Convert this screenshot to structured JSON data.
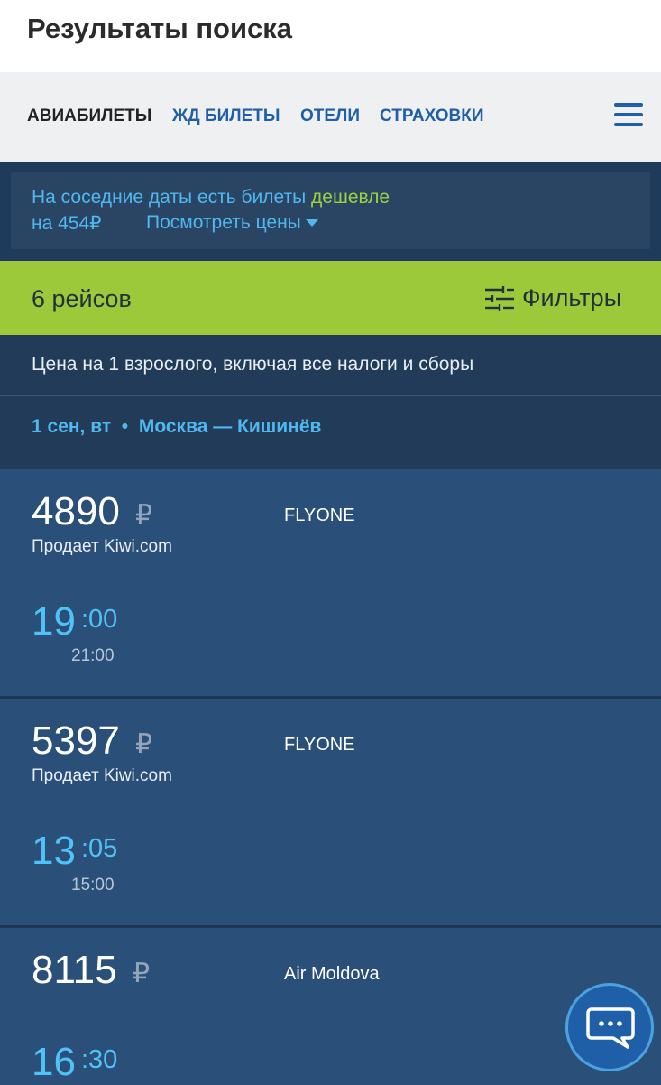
{
  "header": {
    "title": "Результаты поиска"
  },
  "nav": {
    "tabs": [
      {
        "label": "АВИАБИЛЕТЫ",
        "active": true
      },
      {
        "label": "ЖД БИЛЕТЫ",
        "active": false
      },
      {
        "label": "ОТЕЛИ",
        "active": false
      },
      {
        "label": "СТРАХОВКИ",
        "active": false
      }
    ],
    "menu_icon": "hamburger-menu-icon"
  },
  "notice": {
    "text_before": "На соседние даты есть билеты ",
    "cheaper": "дешевле",
    "amount": "на 454₽",
    "link": "Посмотреть цены"
  },
  "results": {
    "count": "6 рейсов",
    "filters_label": "Фильтры",
    "filters_icon": "sliders-icon"
  },
  "price_note": "Цена на 1 взрослого, включая все налоги и сборы",
  "route": {
    "text": "1 сен, вт  •  Москва — Кишинёв"
  },
  "flights": [
    {
      "price": "4890",
      "currency": "₽",
      "seller": "Продает Kiwi.com",
      "airline": "FLYONE",
      "dep_hour": "19",
      "dep_min": ":00",
      "arr": "21:00"
    },
    {
      "price": "5397",
      "currency": "₽",
      "seller": "Продает Kiwi.com",
      "airline": "FLYONE",
      "dep_hour": "13",
      "dep_min": ":05",
      "arr": "15:00"
    },
    {
      "price": "8115",
      "currency": "₽",
      "seller": "",
      "airline": "Air Moldova",
      "dep_hour": "16",
      "dep_min": ":30",
      "arr": ""
    }
  ],
  "chat": {
    "icon": "chat-bubble-icon"
  },
  "colors": {
    "accent_blue": "#1f5fa8",
    "green_bar": "#9cc93a",
    "link_blue": "#4fb8ef",
    "cheaper_green": "#9cd23f"
  }
}
